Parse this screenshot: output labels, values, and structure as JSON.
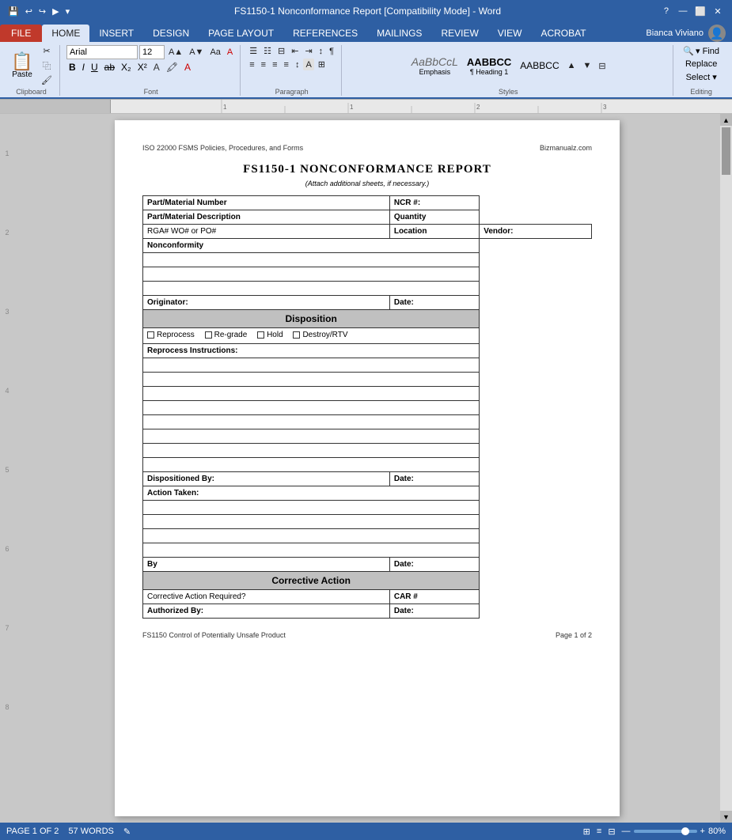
{
  "titleBar": {
    "title": "FS1150-1 Nonconformance Report [Compatibility Mode] - Word",
    "quickAccess": [
      "💾",
      "↩",
      "↪",
      "▶",
      "⊞"
    ],
    "winControls": [
      "?",
      "—",
      "⬜",
      "✕"
    ],
    "user": "Bianca Viviano"
  },
  "ribbon": {
    "tabs": [
      "FILE",
      "HOME",
      "INSERT",
      "DESIGN",
      "PAGE LAYOUT",
      "REFERENCES",
      "MAILINGS",
      "REVIEW",
      "VIEW",
      "ACROBAT"
    ],
    "activeTab": "HOME",
    "fontName": "Arial",
    "fontSize": "12",
    "paragraphLabel": "Paragraph",
    "fontLabel": "Font",
    "clipboardLabel": "Clipboard",
    "stylesLabel": "Styles",
    "editingLabel": "Editing",
    "pasteLabel": "Paste",
    "findLabel": "▾ Find",
    "replaceLabel": "Replace",
    "selectLabel": "Select ▾",
    "styles": [
      {
        "name": "Emphasis",
        "preview": "AaBbCcL"
      },
      {
        "name": "¶ Heading 1",
        "preview": "AABBCC"
      },
      {
        "name": "AABBCC",
        "preview": "AABBCC"
      }
    ]
  },
  "document": {
    "headerLeft": "ISO 22000 FSMS Policies, Procedures, and Forms",
    "headerRight": "Bizmanualz.com",
    "title": "FS1150-1   NONCONFORMANCE REPORT",
    "subtitle": "(Attach additional sheets, if necessary.)",
    "formFields": {
      "partMaterialNumber": "Part/Material Number",
      "ncrNumber": "NCR #:",
      "partMaterialDescription": "Part/Material Description",
      "quantity": "Quantity",
      "rgaLabel": "RGA# WO# or PO#",
      "location": "Location",
      "vendor": "Vendor:",
      "nonconformity": "Nonconformity",
      "originator": "Originator:",
      "date1": "Date:",
      "dispositionHeader": "Disposition",
      "reprocess": "Reprocess",
      "regrade": "Re-grade",
      "hold": "Hold",
      "destroyRTV": "Destroy/RTV",
      "reprocessInstructions": "Reprocess Instructions:",
      "dispositionedBy": "Dispositioned By:",
      "date2": "Date:",
      "actionTaken": "Action Taken:",
      "by": "By",
      "date3": "Date:",
      "correctiveActionHeader": "Corrective Action",
      "correctiveActionRequired": "Corrective Action Required?",
      "carNumber": "CAR #",
      "authorizedBy": "Authorized By:",
      "date4": "Date:"
    },
    "footer": {
      "left": "FS1150 Control of Potentially Unsafe Product",
      "right": "Page 1 of 2"
    }
  },
  "statusBar": {
    "pageInfo": "PAGE 1 OF 2",
    "wordCount": "57 WORDS",
    "zoom": "80%",
    "viewIcons": [
      "⊞",
      "≡",
      "⊟"
    ]
  }
}
